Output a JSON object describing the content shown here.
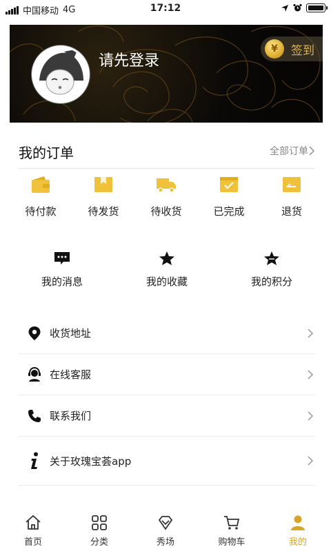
{
  "status_bar": {
    "carrier": "中国移动",
    "network": "4G",
    "time": "17:12"
  },
  "profile": {
    "login_prompt": "请先登录",
    "sign_in_label": "签到",
    "coin_symbol": "¥"
  },
  "orders": {
    "title": "我的订单",
    "all_orders_label": "全部订单",
    "items": [
      {
        "label": "待付款",
        "icon": "wallet-icon"
      },
      {
        "label": "待发货",
        "icon": "package-icon"
      },
      {
        "label": "待收货",
        "icon": "truck-icon"
      },
      {
        "label": "已完成",
        "icon": "check-box-icon"
      },
      {
        "label": "退货",
        "icon": "return-icon"
      }
    ]
  },
  "features": [
    {
      "label": "我的消息",
      "icon": "message-icon"
    },
    {
      "label": "我的收藏",
      "icon": "star-icon"
    },
    {
      "label": "我的积分",
      "icon": "points-star-icon"
    }
  ],
  "menu": [
    {
      "label": "收货地址",
      "icon": "location-pin-icon"
    },
    {
      "label": "在线客服",
      "icon": "customer-service-icon"
    },
    {
      "label": "联系我们",
      "icon": "phone-icon"
    },
    {
      "label": "关于玫瑰宝荟app",
      "icon": "info-icon"
    }
  ],
  "tabs": [
    {
      "label": "首页",
      "icon": "home-icon",
      "active": false
    },
    {
      "label": "分类",
      "icon": "category-grid-icon",
      "active": false
    },
    {
      "label": "秀场",
      "icon": "diamond-icon",
      "active": false
    },
    {
      "label": "购物车",
      "icon": "cart-icon",
      "active": false
    },
    {
      "label": "我的",
      "icon": "person-icon",
      "active": true
    }
  ],
  "colors": {
    "accent": "#D9A528",
    "hero_bg": "#0B0907",
    "rose_lines": "#6B4A1A"
  }
}
